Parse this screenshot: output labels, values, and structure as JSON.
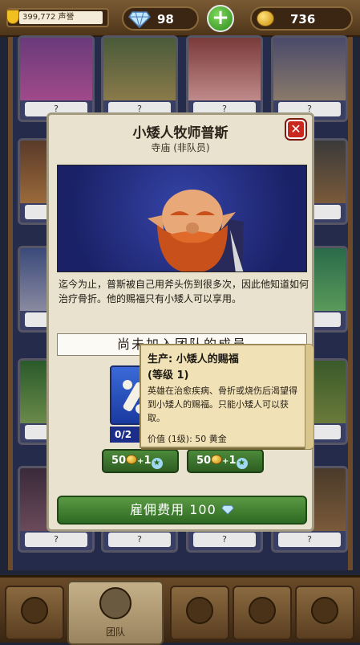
{
  "topbar": {
    "reputation": "399,772 声誉",
    "gems": "98",
    "gold": "736"
  },
  "cards": {
    "unknown_label": "?"
  },
  "modal": {
    "title": "小矮人牧师普斯",
    "subtitle": "寺庙 (非队员)",
    "description": "迄今为止，普斯被自己用斧头伤到很多次，因此他知道如何治疗骨折。他的赐福只有小矮人可以享用。",
    "not_joined": "尚未加入团队的成员",
    "item_count": "0/2",
    "cost_left": {
      "gold": "50",
      "plus": "+",
      "points": "1"
    },
    "cost_right": {
      "gold": "50",
      "plus": "+",
      "points": "1"
    },
    "hire_label": "雇佣费用 100"
  },
  "tooltip": {
    "title": "生产: 小矮人的赐福",
    "level": "(等级 1)",
    "body": "英雄在治愈疾病、骨折或烧伤后渴望得到小矮人的赐福。只能小矮人可以获取。",
    "value": "价值 (1级): 50 黄金"
  },
  "bottomnav": {
    "active_label": "团队"
  },
  "colors": {
    "accent_green": "#3f7a2e",
    "close_red": "#c9281e",
    "modal_bg": "#e9e2ce",
    "portrait_blue": "#1a2166"
  }
}
